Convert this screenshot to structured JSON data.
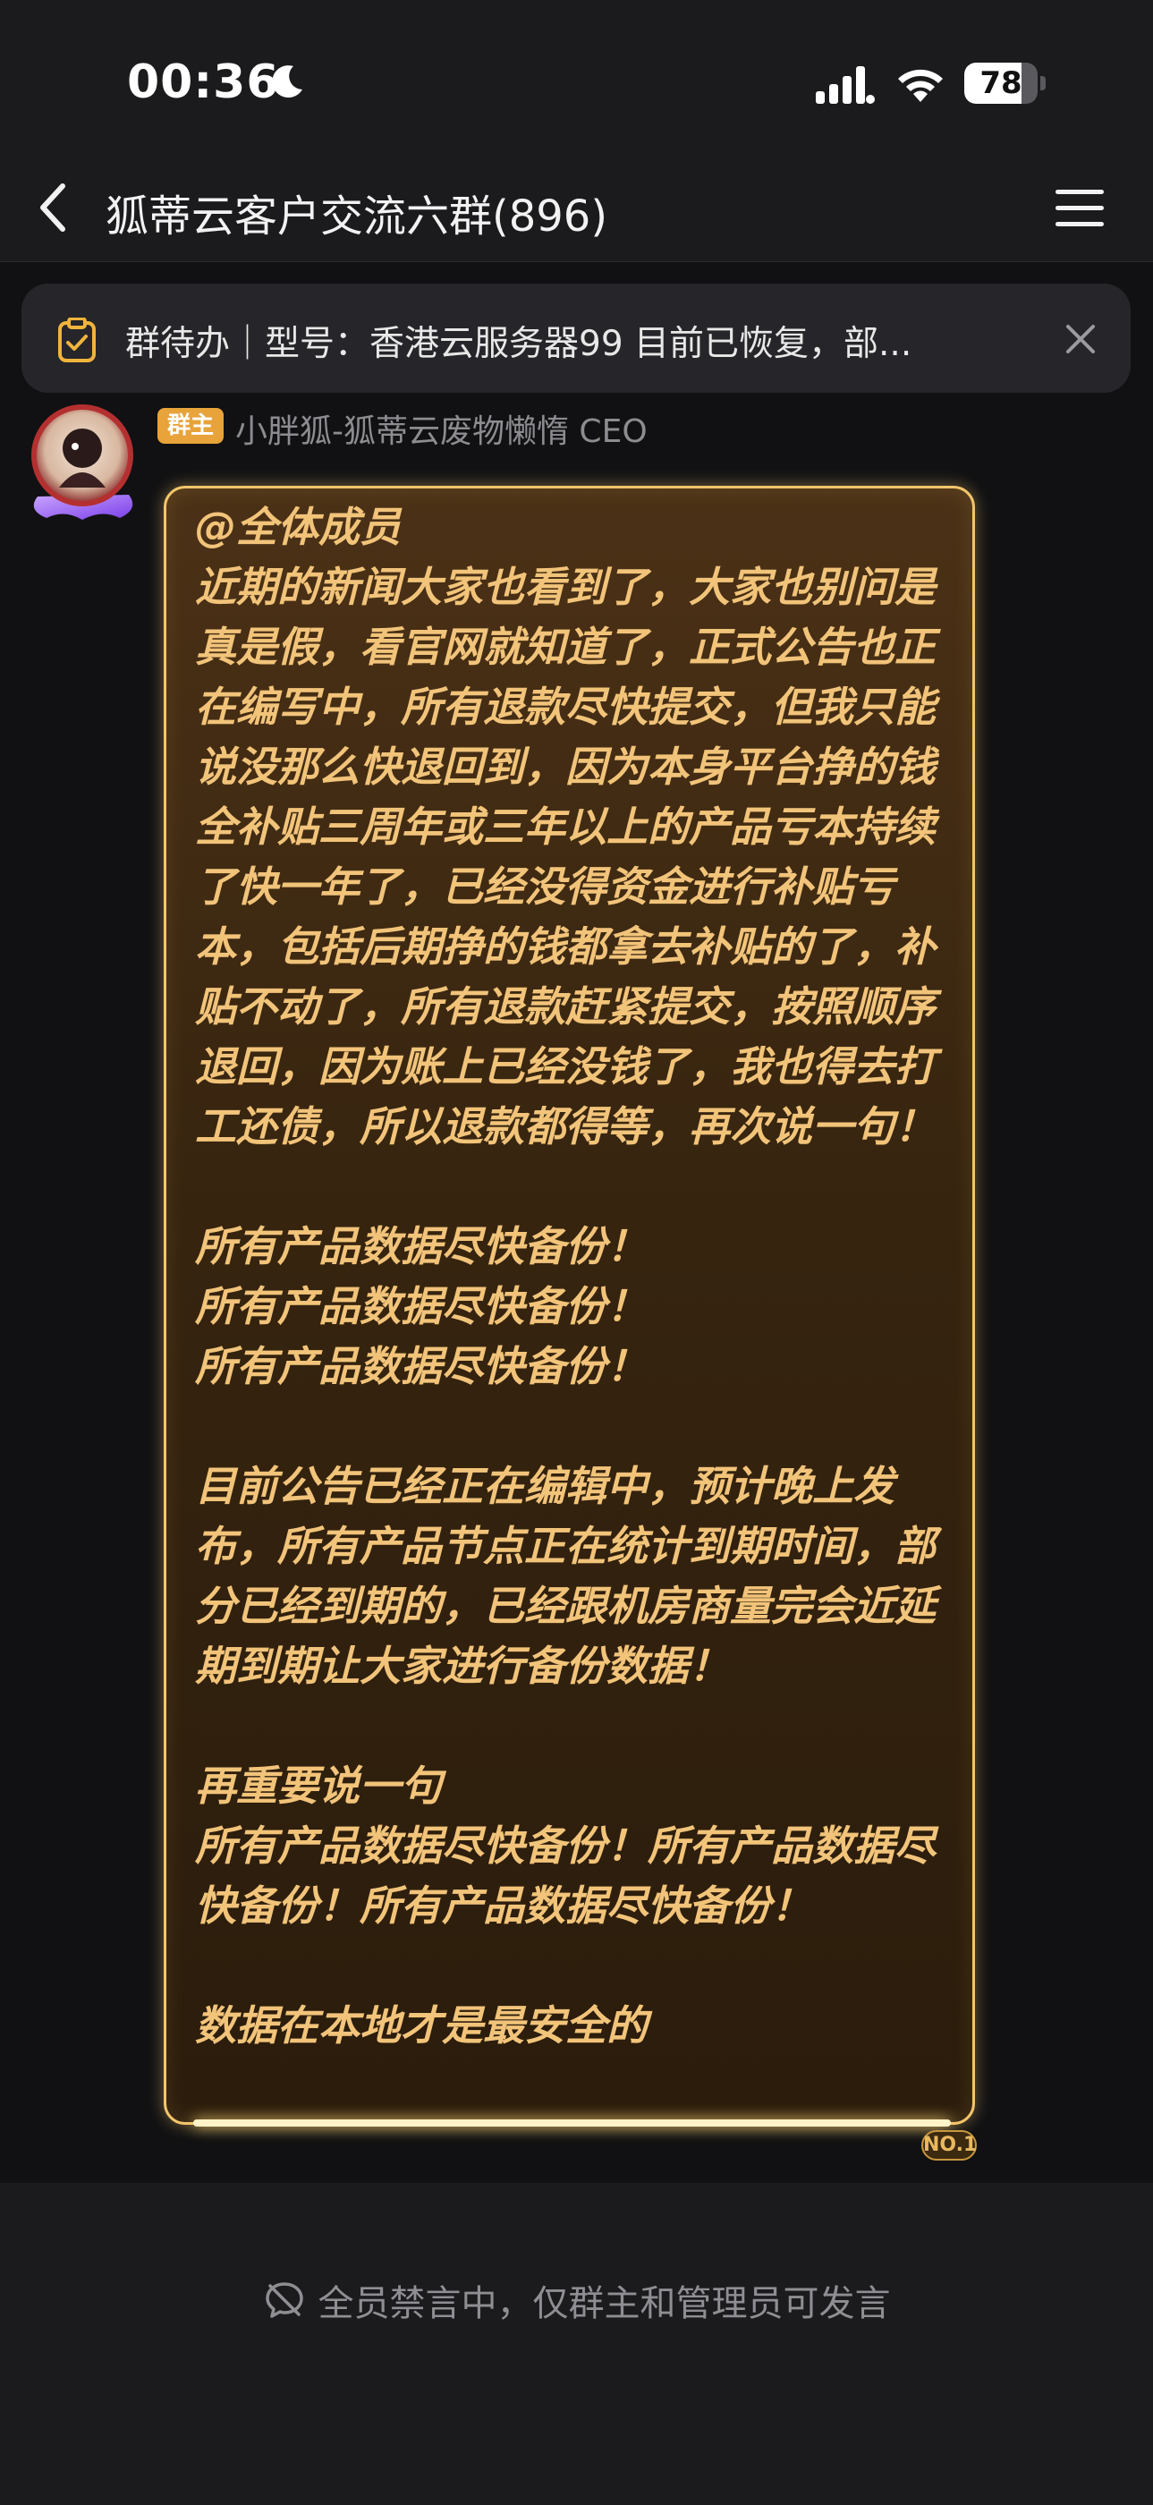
{
  "status_bar": {
    "time": "00:36",
    "battery_level": "78",
    "icons": [
      "moon-icon",
      "signal-icon",
      "wifi-icon",
      "battery-icon"
    ]
  },
  "nav": {
    "title": "狐蒂云客户交流六群(896)",
    "icons": [
      "back-icon",
      "menu-icon"
    ]
  },
  "todo_banner": {
    "text": "群待办｜型号：香港云服务器99 目前已恢复，部..."
  },
  "message": {
    "badge": "群主",
    "sender": "小胖狐-狐蒂云废物懒惰 CEO",
    "text": "@全体成员\n近期的新闻大家也看到了，大家也别问是真是假，看官网就知道了，正式公告也正在编写中，所有退款尽快提交，但我只能说没那么快退回到，因为本身平台挣的钱全补贴三周年或三年以上的产品亏本持续了快一年了，已经没得资金进行补贴亏本，包括后期挣的钱都拿去补贴的了，补贴不动了，所有退款赶紧提交，按照顺序退回，因为账上已经没钱了，我也得去打工还债，所以退款都得等，再次说一句！\n\n所有产品数据尽快备份！\n所有产品数据尽快备份！\n所有产品数据尽快备份！\n\n目前公告已经正在编辑中，预计晚上发布，所有产品节点正在统计到期时间，部分已经到期的，已经跟机房商量完会近延期到期让大家进行备份数据！\n\n再重要说一句\n所有产品数据尽快备份！所有产品数据尽快备份！所有产品数据尽快备份！\n\n数据在本地才是最安全的",
    "bubble_tag": "NO.1",
    "bubble_color": "#f3c56b",
    "text_color": "#f2c47a"
  },
  "footer": {
    "mute_notice": "全员禁言中，仅群主和管理员可发言"
  }
}
